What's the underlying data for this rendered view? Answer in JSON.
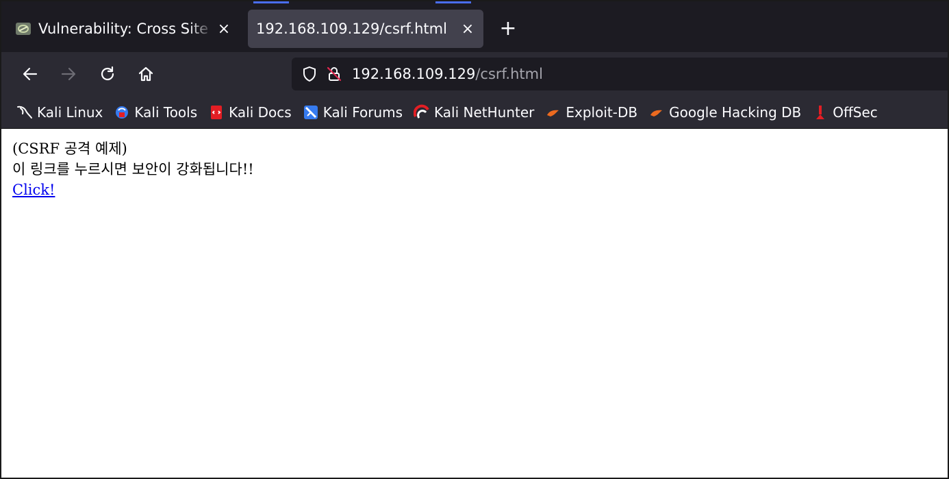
{
  "tabs": [
    {
      "title": "Vulnerability: Cross Site Request Forgery (CSRF)",
      "active": false,
      "favicon": "dvwa-icon"
    },
    {
      "title": "192.168.109.129/csrf.html",
      "active": true,
      "favicon": ""
    }
  ],
  "tab_close_glyph": "×",
  "new_tab_glyph": "+",
  "nav": {
    "url_host": "192.168.109.129",
    "url_path": "/csrf.html"
  },
  "bookmarks": [
    {
      "label": "Kali Linux",
      "icon": "kali-dragon-icon",
      "color": "#ffffff"
    },
    {
      "label": "Kali Tools",
      "icon": "kali-tools-icon",
      "color": "#367bf0"
    },
    {
      "label": "Kali Docs",
      "icon": "kali-docs-icon",
      "color": "#e31e24"
    },
    {
      "label": "Kali Forums",
      "icon": "kali-forums-icon",
      "color": "#367bf0"
    },
    {
      "label": "Kali NetHunter",
      "icon": "kali-nethunter-icon",
      "color": "#e31e24"
    },
    {
      "label": "Exploit-DB",
      "icon": "exploit-db-icon",
      "color": "#ec6a1f"
    },
    {
      "label": "Google Hacking DB",
      "icon": "ghdb-icon",
      "color": "#ec6a1f"
    },
    {
      "label": "OffSec",
      "icon": "offsec-icon",
      "color": "#e31e24"
    }
  ],
  "page": {
    "line1": "(CSRF 공격 예제)",
    "line2": "이 링크를 누르시면 보안이 강화됩니다!!",
    "link_text": "Click!"
  },
  "colors": {
    "tabstrip_bg": "#1c1b22",
    "toolbar_bg": "#2b2a33",
    "active_tab_bg": "#42414d",
    "link": "#0000ee"
  }
}
